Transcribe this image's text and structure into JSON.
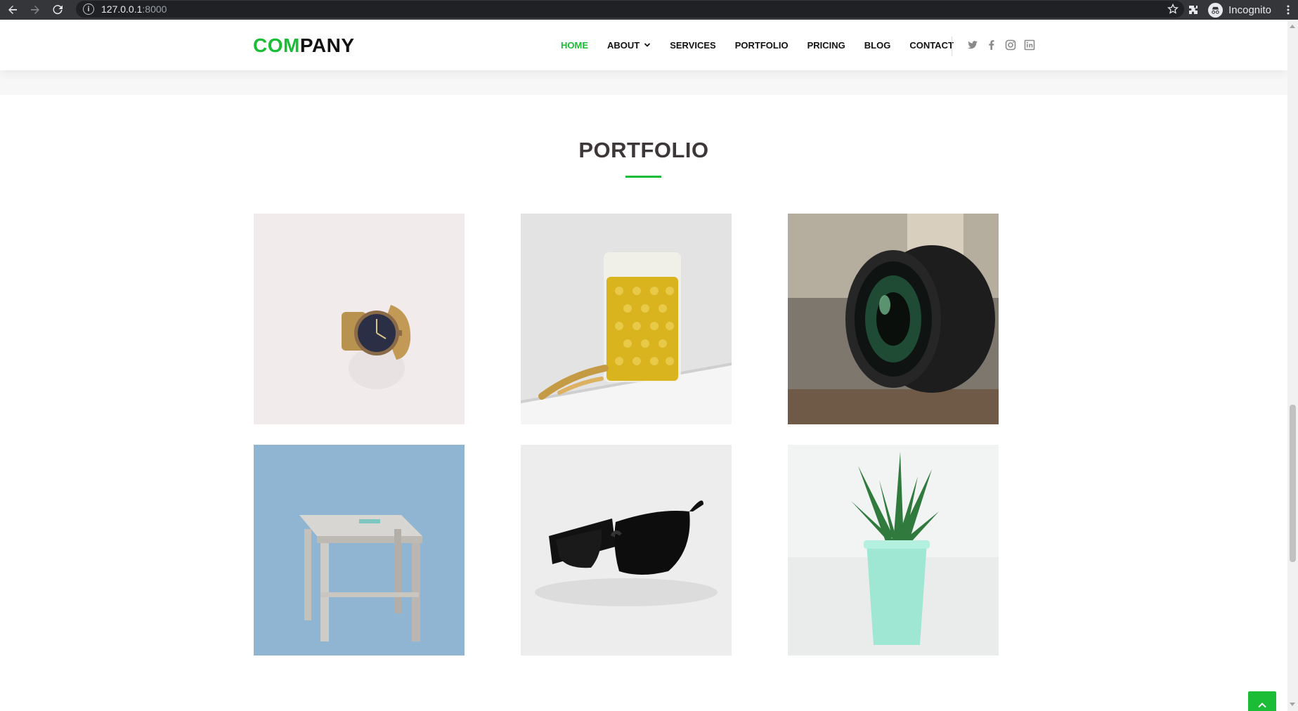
{
  "browser": {
    "url_host": "127.0.0.1",
    "url_port": ":8000",
    "profile_label": "Incognito"
  },
  "header": {
    "logo_part1": "COM",
    "logo_part2": "PANY",
    "nav": [
      {
        "label": "HOME",
        "active": true
      },
      {
        "label": "ABOUT",
        "has_dropdown": true
      },
      {
        "label": "SERVICES"
      },
      {
        "label": "PORTFOLIO"
      },
      {
        "label": "PRICING"
      },
      {
        "label": "BLOG"
      },
      {
        "label": "CONTACT"
      }
    ],
    "social_icons": [
      "twitter-icon",
      "facebook-icon",
      "instagram-icon",
      "linkedin-icon"
    ]
  },
  "portfolio": {
    "title": "PORTFOLIO",
    "items": [
      {
        "subject": "wristwatch",
        "background": "#f1ebeb"
      },
      {
        "subject": "glass-of-drink",
        "background": "#e3e3e4"
      },
      {
        "subject": "camera-lens",
        "background": "#6e6a62"
      },
      {
        "subject": "wooden-stool",
        "background": "#8fb5d2"
      },
      {
        "subject": "sunglasses",
        "background": "#ededed"
      },
      {
        "subject": "potted-succulent",
        "background": "#f2f4f4"
      }
    ]
  },
  "colors": {
    "accent": "#1bbd36",
    "heading": "#3e3738"
  },
  "back_to_top_icon": "chevron-up-icon"
}
